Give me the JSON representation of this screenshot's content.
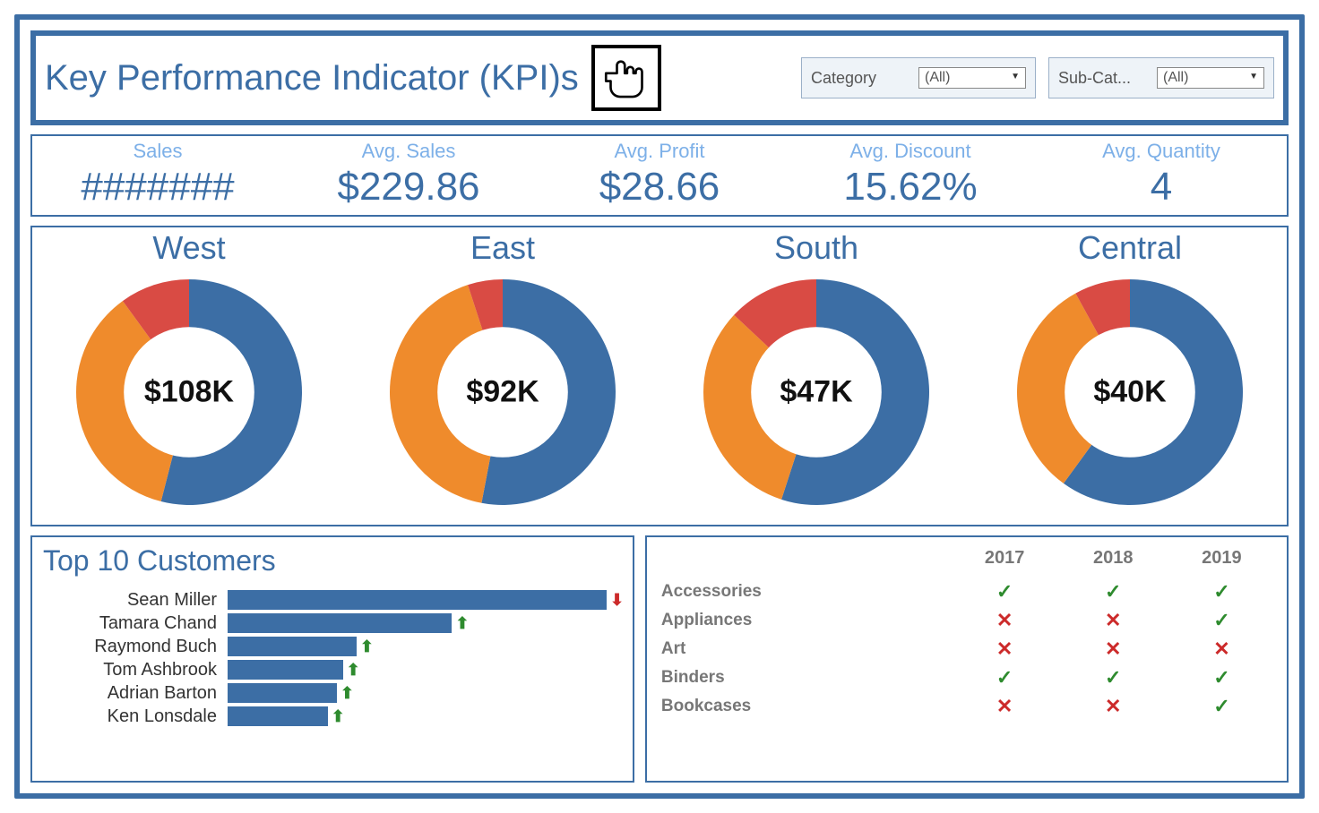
{
  "header": {
    "title": "Key Performance Indicator (KPI)s",
    "filters": [
      {
        "label": "Category",
        "value": "(All)"
      },
      {
        "label": "Sub-Cat...",
        "value": "(All)"
      }
    ]
  },
  "kpis": [
    {
      "label": "Sales",
      "value": "#######"
    },
    {
      "label": "Avg. Sales",
      "value": "$229.86"
    },
    {
      "label": "Avg. Profit",
      "value": "$28.66"
    },
    {
      "label": "Avg. Discount",
      "value": "15.62%"
    },
    {
      "label": "Avg. Quantity",
      "value": "4"
    }
  ],
  "chart_data": {
    "donuts": {
      "type": "pie",
      "title": "",
      "series_colors": {
        "blue": "#3c6ea5",
        "orange": "#ef8b2c",
        "red": "#d94b44"
      },
      "regions": [
        {
          "name": "West",
          "center": "$108K",
          "slices": [
            {
              "name": "blue",
              "value": 54
            },
            {
              "name": "orange",
              "value": 36
            },
            {
              "name": "red",
              "value": 10
            }
          ]
        },
        {
          "name": "East",
          "center": "$92K",
          "slices": [
            {
              "name": "blue",
              "value": 53
            },
            {
              "name": "orange",
              "value": 42
            },
            {
              "name": "red",
              "value": 5
            }
          ]
        },
        {
          "name": "South",
          "center": "$47K",
          "slices": [
            {
              "name": "blue",
              "value": 55
            },
            {
              "name": "orange",
              "value": 32
            },
            {
              "name": "red",
              "value": 13
            }
          ]
        },
        {
          "name": "Central",
          "center": "$40K",
          "slices": [
            {
              "name": "blue",
              "value": 60
            },
            {
              "name": "orange",
              "value": 32
            },
            {
              "name": "red",
              "value": 8
            }
          ]
        }
      ]
    },
    "top_customers": {
      "type": "bar",
      "title": "Top 10 Customers",
      "xlabel": "",
      "ylabel": "",
      "ylim": [
        0,
        26000
      ],
      "categories": [
        "Sean Miller",
        "Tamara Chand",
        "Raymond Buch",
        "Tom Ashbrook",
        "Adrian Barton",
        "Ken Lonsdale"
      ],
      "values": [
        25000,
        14800,
        8500,
        7600,
        7200,
        6600
      ],
      "trend": [
        "down",
        "up",
        "up",
        "up",
        "up",
        "up"
      ]
    },
    "category_matrix": {
      "type": "table",
      "years": [
        "2017",
        "2018",
        "2019"
      ],
      "rows": [
        {
          "name": "Accessories",
          "cells": [
            "check",
            "check",
            "check"
          ]
        },
        {
          "name": "Appliances",
          "cells": [
            "cross",
            "cross",
            "check"
          ]
        },
        {
          "name": "Art",
          "cells": [
            "cross",
            "cross",
            "cross"
          ]
        },
        {
          "name": "Binders",
          "cells": [
            "check",
            "check",
            "check"
          ]
        },
        {
          "name": "Bookcases",
          "cells": [
            "cross",
            "cross",
            "check"
          ]
        }
      ]
    }
  }
}
